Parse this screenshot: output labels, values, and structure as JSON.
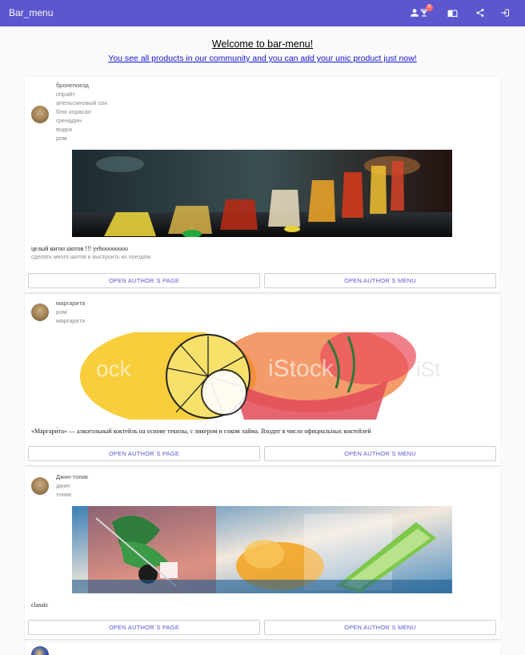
{
  "appbar": {
    "title": "Bar_menu",
    "badge_count": "0",
    "icons": [
      "person-icon",
      "cocktail-icon",
      "menu-book-icon",
      "share-icon",
      "login-icon"
    ]
  },
  "header": {
    "welcome": "Welcome to bar-menu!",
    "subtitle": "You see all products in our community and you can add your unic product just now!"
  },
  "cards": [
    {
      "name": "бронепоезд",
      "ingredients": [
        "спрайт",
        "апельсиновый сок",
        "блю корасао",
        "гренадин",
        "водка",
        "ром"
      ],
      "description": "целый вагон шотов !!! yehoooooooo",
      "subdescription": "сделать много шотов и выстроить их поездом",
      "author_page_label": "OPEN AUTHOR`S PAGE",
      "author_menu_label": "OPEN AUTHOR`S MENU"
    },
    {
      "name": "маргарита",
      "ingredients": [
        "ром",
        "маргарита"
      ],
      "description": "«Маргари́та» — алкогольный коктейль на основе текилы, с ликером и соком лайма. Входит в число официальных коктейлей",
      "subdescription": "",
      "author_page_label": "OPEN AUTHOR`S PAGE",
      "author_menu_label": "OPEN AUTHOR`S MENU"
    },
    {
      "name": "Джин-тоник",
      "ingredients": [
        "джин",
        "тоник"
      ],
      "description": "classic",
      "subdescription": "",
      "author_page_label": "OPEN AUTHOR`S PAGE",
      "author_menu_label": "OPEN AUTHOR`S MENU"
    }
  ],
  "colors": {
    "appbar": "#5c57cf",
    "button_text": "#5c57cf",
    "link": "#1515d6",
    "badge": "#ff6b6b"
  }
}
